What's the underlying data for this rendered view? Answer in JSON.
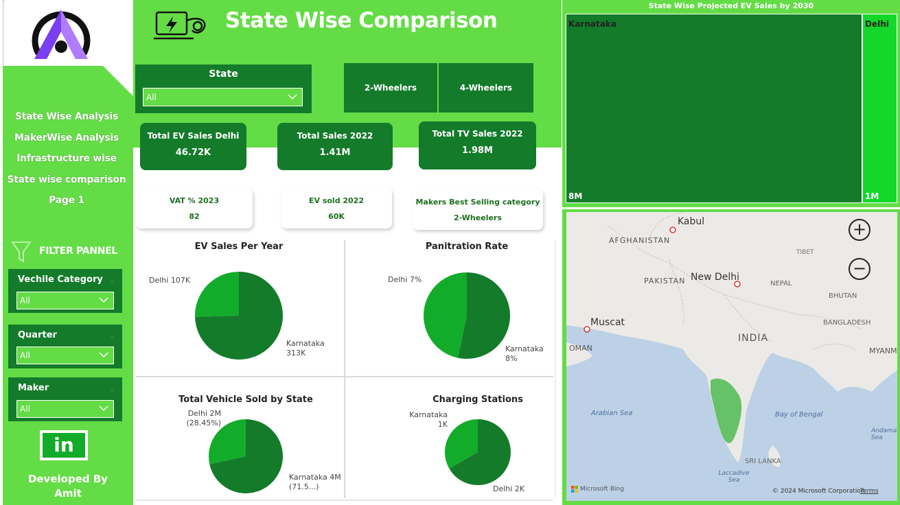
{
  "sidebar": {
    "nav": [
      "State Wise Analysis",
      "MakerWise Analysis",
      "Infrastructure wise",
      "State wise comparison",
      "Page 1"
    ],
    "filter_panel_title": "FILTER PANNEL",
    "filters": [
      {
        "label": "Vechile Category",
        "value": "All"
      },
      {
        "label": "Quarter",
        "value": "All"
      },
      {
        "label": "Maker",
        "value": "All"
      }
    ],
    "linkedin_label": "in",
    "developed_by": "Developed By",
    "author": "Amit"
  },
  "header": {
    "title": "State Wise Comparison",
    "state_slicer": {
      "label": "State",
      "value": "All"
    },
    "toggle": [
      "2-Wheelers",
      "4-Wheelers"
    ]
  },
  "kpis": [
    {
      "title": "Total EV Sales Delhi",
      "value": "46.72K"
    },
    {
      "title": "Total Sales 2022",
      "value": "1.41M"
    },
    {
      "title": "Total TV Sales 2022",
      "value": "1.98M"
    }
  ],
  "small_cards": [
    {
      "title": "VAT % 2023",
      "value": "82"
    },
    {
      "title": "EV sold 2022",
      "value": "60K"
    },
    {
      "title": "Makers Best Selling category",
      "value": "2-Wheelers"
    }
  ],
  "colors": {
    "accent": "#64dc46",
    "dark": "#137b2a",
    "slice_dark": "#137b2a",
    "slice_light": "#13ac2a"
  },
  "chart_data": [
    {
      "type": "pie",
      "title": "EV Sales Per Year",
      "labels": [
        "Delhi 107K",
        "Karnataka 313K"
      ],
      "series": [
        {
          "values": [
            107,
            313
          ]
        }
      ]
    },
    {
      "type": "pie",
      "title": "Panitration Rate",
      "labels": [
        "Delhi 7%",
        "Karnataka 8%"
      ],
      "series": [
        {
          "values": [
            7,
            8
          ]
        }
      ]
    },
    {
      "type": "pie",
      "title": "Total Vehicle Sold by State",
      "labels": [
        "Delhi 2M (28.45%)",
        "Karnataka 4M (71.5...)"
      ],
      "series": [
        {
          "values": [
            28.45,
            71.55
          ]
        }
      ]
    },
    {
      "type": "pie",
      "title": "Charging Stations",
      "labels": [
        "Karnataka 1K",
        "Delhi 2K"
      ],
      "series": [
        {
          "values": [
            1,
            2
          ]
        }
      ]
    },
    {
      "type": "treemap",
      "title": "State Wise Projected EV Sales by 2030",
      "labels": [
        "Karnataka",
        "Delhi"
      ],
      "values": [
        "8M",
        "1M"
      ],
      "series": [
        {
          "values": [
            8,
            1
          ]
        }
      ]
    }
  ],
  "map": {
    "labels": [
      "Kabul",
      "AFGHANISTAN",
      "TIBET",
      "PAKISTAN",
      "New Delhi",
      "NEPAL",
      "BHUTAN",
      "Muscat",
      "BANGLADESH",
      "INDIA",
      "OMAN",
      "MYANM",
      "Arabian Sea",
      "Bay of Bengal",
      "Andama Sea",
      "SRI LANKA",
      "Laccadive Sea"
    ],
    "zoom_in": "+",
    "zoom_out": "−",
    "bing": "Microsoft Bing",
    "copyright": "© 2024 Microsoft Corporation",
    "terms": "Terms"
  }
}
